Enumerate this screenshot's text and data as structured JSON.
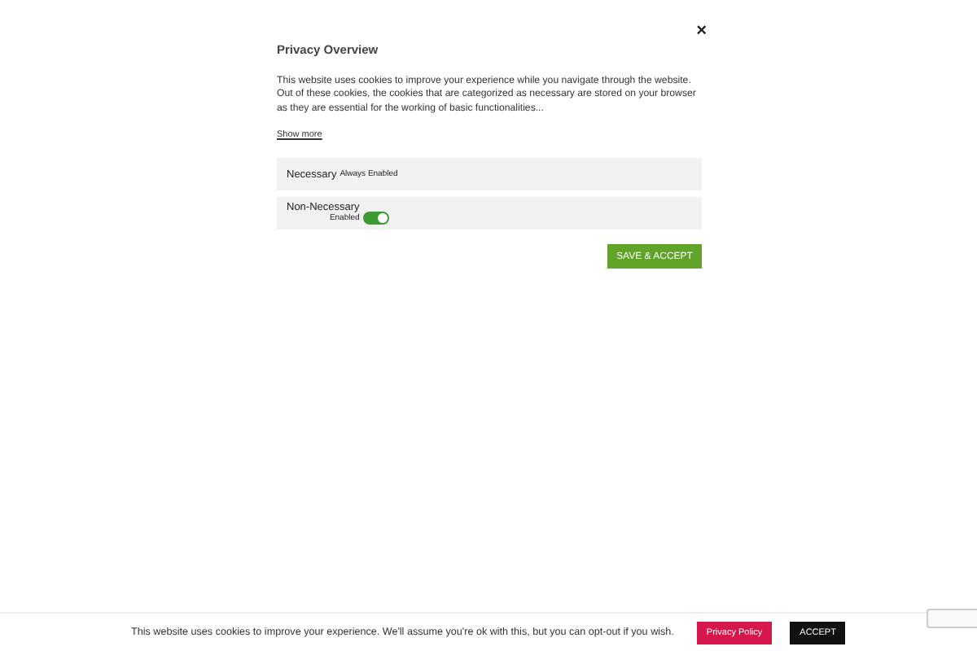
{
  "modal": {
    "title": "Privacy Overview",
    "close": "×",
    "description": "This website uses cookies to improve your experience while you navigate through the website. Out of these cookies, the cookies that are categorized as necessary are stored on your browser as they are essential for the working of basic functionalities...",
    "show_more": "Show more",
    "categories": [
      {
        "kind": "fixed",
        "name": "Necessary",
        "status": "Always Enabled"
      },
      {
        "kind": "toggle",
        "name": "Non-Necessary",
        "status": "Enabled",
        "on": true
      }
    ],
    "save_button": "SAVE & ACCEPT"
  },
  "cookie_bar": {
    "text": "This website uses cookies to improve your experience. We'll assume you're ok with this, but you can opt-out if you wish.",
    "policy_button": "Privacy Policy",
    "accept_button": "ACCEPT"
  }
}
